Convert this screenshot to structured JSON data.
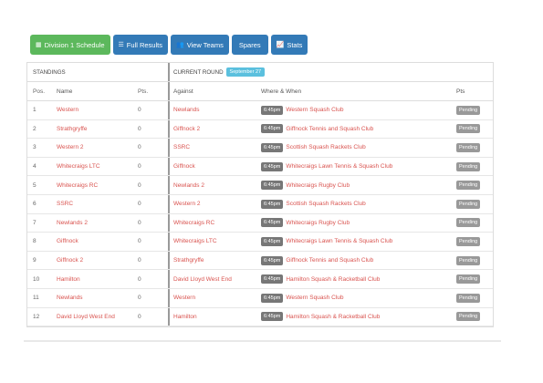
{
  "toolbar": {
    "buttons": [
      {
        "label": "Division 1 Schedule",
        "icon": "calendar-icon",
        "color": "#5cb85c"
      },
      {
        "label": "Full Results",
        "icon": "list-icon",
        "color": "#337ab7"
      },
      {
        "label": "View Teams",
        "icon": "users-icon",
        "color": "#337ab7"
      },
      {
        "label": "Spares",
        "icon": "",
        "color": "#337ab7"
      },
      {
        "label": "Stats",
        "icon": "chart-icon",
        "color": "#337ab7"
      }
    ]
  },
  "standings": {
    "title": "STANDINGS",
    "headers": {
      "pos": "Pos.",
      "name": "Name",
      "pts": "Pts."
    }
  },
  "round": {
    "title": "CURRENT ROUND",
    "date": "September 27",
    "headers": {
      "against": "Against",
      "where": "Where & When",
      "pts": "Pts"
    }
  },
  "rows": [
    {
      "pos": "1",
      "name": "Western",
      "pts": "0",
      "against": "Newlands",
      "time": "6:45pm",
      "venue": "Western Squash Club",
      "status": "Pending"
    },
    {
      "pos": "2",
      "name": "Strathgryffe",
      "pts": "0",
      "against": "Giffnock 2",
      "time": "6:45pm",
      "venue": "Giffnock Tennis and Squash Club",
      "status": "Pending"
    },
    {
      "pos": "3",
      "name": "Western 2",
      "pts": "0",
      "against": "SSRC",
      "time": "6:45pm",
      "venue": "Scottish Squash Rackets Club",
      "status": "Pending"
    },
    {
      "pos": "4",
      "name": "Whitecraigs LTC",
      "pts": "0",
      "against": "Giffnock",
      "time": "6:45pm",
      "venue": "Whitecraigs Lawn Tennis & Squash Club",
      "status": "Pending"
    },
    {
      "pos": "5",
      "name": "Whitecraigs RC",
      "pts": "0",
      "against": "Newlands 2",
      "time": "6:45pm",
      "venue": "Whitecraigs Rugby Club",
      "status": "Pending"
    },
    {
      "pos": "6",
      "name": "SSRC",
      "pts": "0",
      "against": "Western 2",
      "time": "6:45pm",
      "venue": "Scottish Squash Rackets Club",
      "status": "Pending"
    },
    {
      "pos": "7",
      "name": "Newlands 2",
      "pts": "0",
      "against": "Whitecraigs RC",
      "time": "6:45pm",
      "venue": "Whitecraigs Rugby Club",
      "status": "Pending"
    },
    {
      "pos": "8",
      "name": "Giffnock",
      "pts": "0",
      "against": "Whitecraigs LTC",
      "time": "6:45pm",
      "venue": "Whitecraigs Lawn Tennis & Squash Club",
      "status": "Pending"
    },
    {
      "pos": "9",
      "name": "Giffnock 2",
      "pts": "0",
      "against": "Strathgryffe",
      "time": "6:45pm",
      "venue": "Giffnock Tennis and Squash Club",
      "status": "Pending"
    },
    {
      "pos": "10",
      "name": "Hamilton",
      "pts": "0",
      "against": "David Lloyd West End",
      "time": "6:45pm",
      "venue": "Hamilton Squash & Racketball Club",
      "status": "Pending"
    },
    {
      "pos": "11",
      "name": "Newlands",
      "pts": "0",
      "against": "Western",
      "time": "6:45pm",
      "venue": "Western Squash Club",
      "status": "Pending"
    },
    {
      "pos": "12",
      "name": "David Lloyd West End",
      "pts": "0",
      "against": "Hamilton",
      "time": "6:45pm",
      "venue": "Hamilton Squash & Racketball Club",
      "status": "Pending"
    }
  ]
}
